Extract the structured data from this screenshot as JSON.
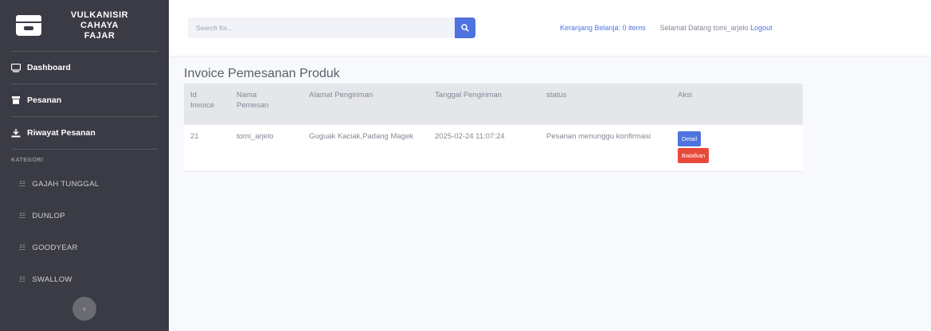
{
  "sidebar": {
    "brand_lines": [
      "VULKANISIR",
      "CAHAYA",
      "FAJAR"
    ],
    "nav": [
      {
        "label": "Dashboard",
        "icon": "tv-icon"
      },
      {
        "label": "Pesanan",
        "icon": "box-icon"
      },
      {
        "label": "Riwayat Pesanan",
        "icon": "download-icon"
      }
    ],
    "heading": "KATEGORI",
    "brands": [
      {
        "label": "GAJAH TUNGGAL"
      },
      {
        "label": "DUNLOP"
      },
      {
        "label": "GOODYEAR"
      },
      {
        "label": "SWALLOW"
      }
    ]
  },
  "topbar": {
    "search_placeholder": "Search for...",
    "cart_text": "Keranjang Belanja: 0 items",
    "welcome_text": "Selamat Datang tomi_arjelo",
    "logout_label": "Logout"
  },
  "main": {
    "title": "Invoice Pemesanan Produk",
    "headers": [
      [
        "Id",
        "Invoice"
      ],
      [
        "Nama",
        "Pemesan"
      ],
      [
        "Alamat Pengiriman"
      ],
      [
        "Tanggal Pengiriman"
      ],
      [
        "status"
      ],
      [
        "Aksi"
      ]
    ],
    "rows": [
      {
        "id": "21",
        "nama": "tomi_arjelo",
        "alamat": "Guguak Kaciak,Padang Magek",
        "tanggal": "2025-02-24 11:07:24",
        "status": "Pesanan menunggu konfirmasi",
        "detail_label": "Detail",
        "batal_label": "Batalkan"
      }
    ]
  },
  "colors": {
    "sidebar_bg": "#3a3b45",
    "accent": "#4e73df",
    "danger": "#e74a3b"
  }
}
